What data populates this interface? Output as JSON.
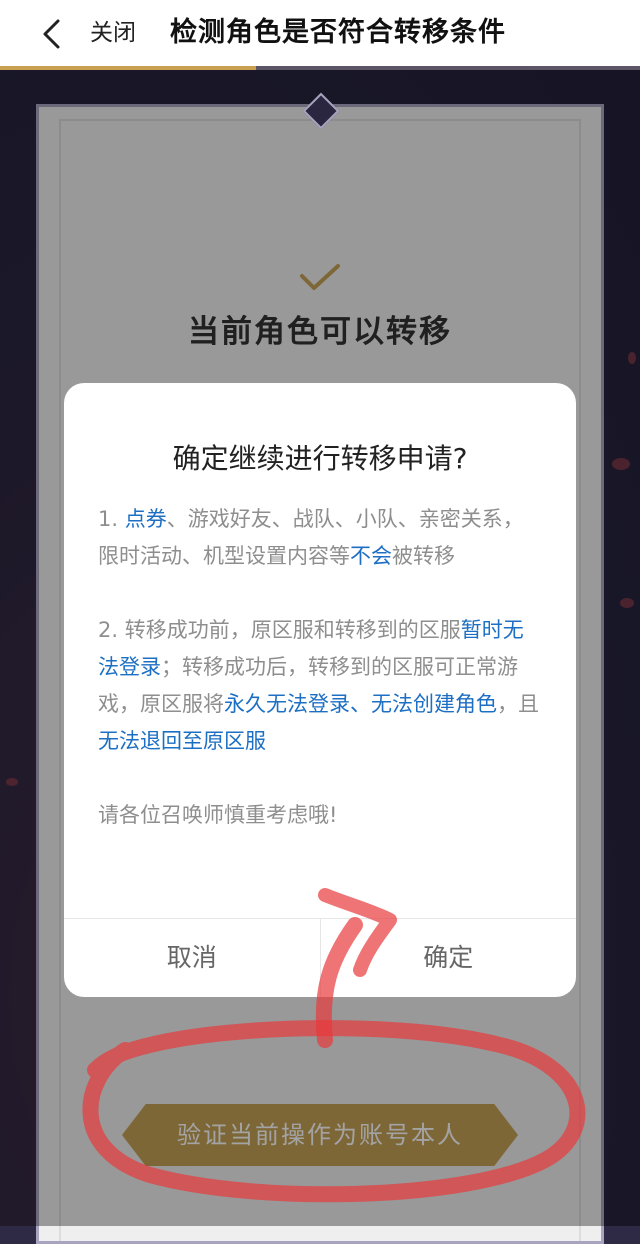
{
  "header": {
    "close_label": "关闭",
    "title": "检测角色是否符合转移条件",
    "back_icon": "chevron-left-icon",
    "progress": 0.4
  },
  "card": {
    "check_icon": "checkmark-icon",
    "status": "当前角色可以转移",
    "verify_button": "验证当前操作为账号本人"
  },
  "dialog": {
    "title": "确定继续进行转移申请?",
    "item1": {
      "prefix": "1. ",
      "hl1": "点券",
      "mid": "、游戏好友、战队、小队、亲密关系，限时活动、机型设置内容等",
      "hl2": "不会",
      "suffix": "被转移"
    },
    "item2": {
      "prefix": "2. 转移成功前，原区服和转移到的区服",
      "hl1": "暂时无法登录",
      "mid": "；转移成功后，转移到的区服可正常游戏，原区服将",
      "hl2": "永久无法登录、无法创建角色",
      "mid2": "，且",
      "hl3": "无法退回至原区服"
    },
    "note": "请各位召唤师慎重考虑哦!",
    "cancel_label": "取消",
    "confirm_label": "确定"
  },
  "colors": {
    "accent_gold": "#c6a257",
    "highlight_blue": "#1d6fc4",
    "annotation_red": "#e8393a"
  }
}
